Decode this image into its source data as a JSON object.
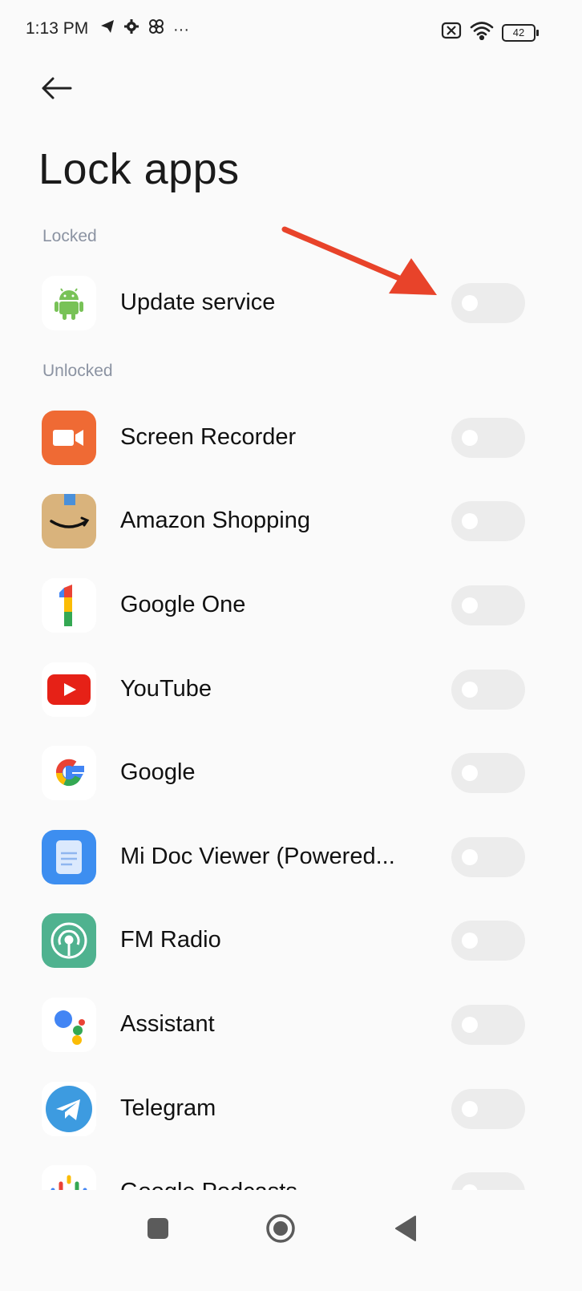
{
  "status_bar": {
    "time": "1:13 PM",
    "left_icons": [
      "telegram-icon",
      "gear-icon",
      "pinwheel-icon",
      "more-dots-icon"
    ],
    "more_dots": "···",
    "battery": "42"
  },
  "page": {
    "title": "Lock apps"
  },
  "sections": {
    "locked_label": "Locked",
    "unlocked_label": "Unlocked"
  },
  "locked_apps": [
    {
      "name": "Update service",
      "icon": "android-icon",
      "locked": false
    }
  ],
  "unlocked_apps": [
    {
      "name": "Screen Recorder",
      "icon": "screen-recorder-icon",
      "locked": false
    },
    {
      "name": "Amazon Shopping",
      "icon": "amazon-icon",
      "locked": false
    },
    {
      "name": "Google One",
      "icon": "google-one-icon",
      "locked": false
    },
    {
      "name": "YouTube",
      "icon": "youtube-icon",
      "locked": false
    },
    {
      "name": "Google",
      "icon": "google-icon",
      "locked": false
    },
    {
      "name": "Mi Doc Viewer (Powered...",
      "icon": "mi-doc-viewer-icon",
      "locked": false
    },
    {
      "name": "FM Radio",
      "icon": "fm-radio-icon",
      "locked": false
    },
    {
      "name": "Assistant",
      "icon": "assistant-icon",
      "locked": false
    },
    {
      "name": "Telegram",
      "icon": "telegram-app-icon",
      "locked": false
    },
    {
      "name": "Google Podcasts",
      "icon": "google-podcasts-icon",
      "locked": false
    }
  ],
  "annotation": {
    "type": "arrow",
    "color": "#e8432a",
    "points_to": "update-service-toggle"
  },
  "nav_bar": {
    "buttons": [
      "recents-button",
      "home-button",
      "back-nav-button"
    ]
  }
}
